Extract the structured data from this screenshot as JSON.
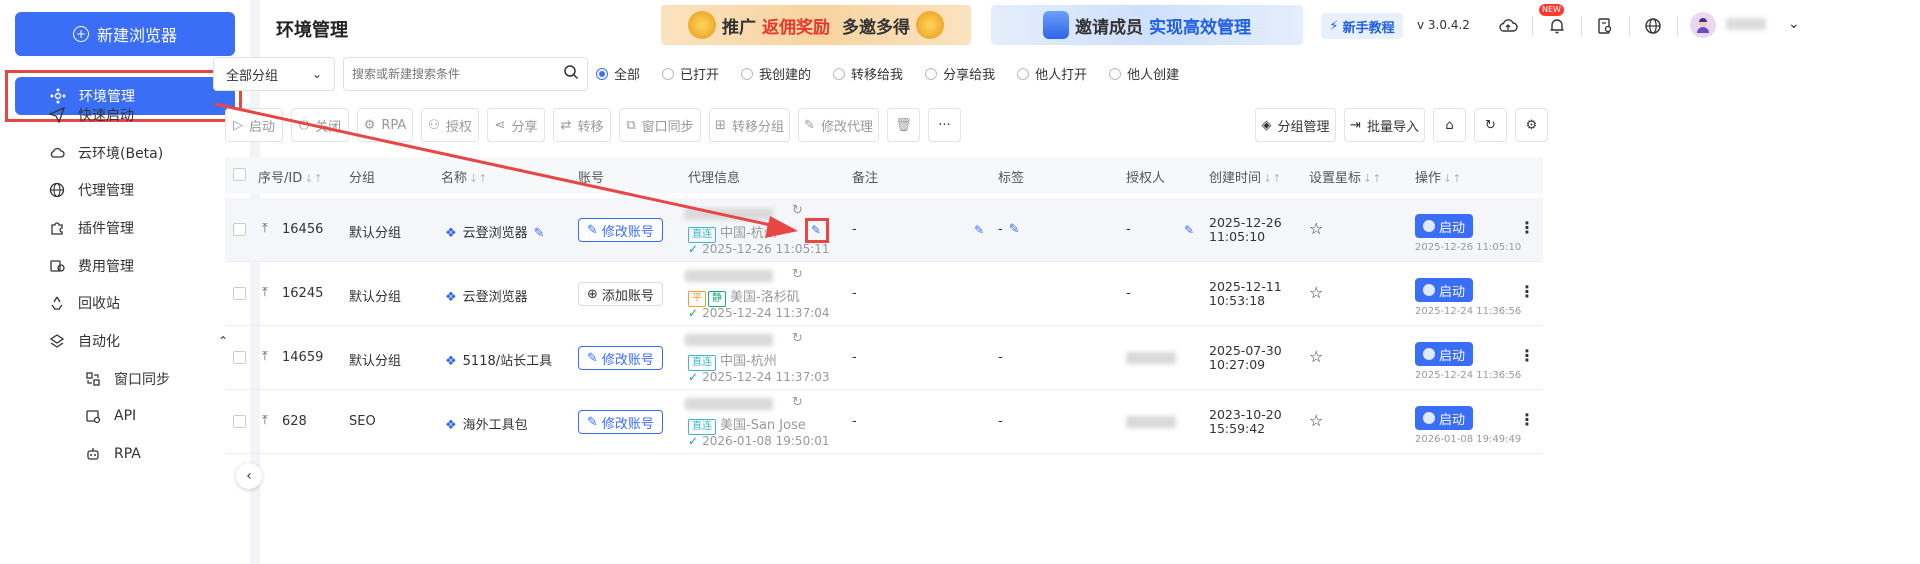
{
  "sidebar": {
    "new_browser": "新建浏览器",
    "items": [
      {
        "label": "环境管理"
      },
      {
        "label": "快速启动"
      },
      {
        "label": "云环境(Beta)"
      },
      {
        "label": "代理管理"
      },
      {
        "label": "插件管理"
      },
      {
        "label": "费用管理"
      },
      {
        "label": "回收站"
      },
      {
        "label": "自动化"
      },
      {
        "label": "窗口同步"
      },
      {
        "label": "API"
      },
      {
        "label": "RPA"
      }
    ]
  },
  "header": {
    "title": "环境管理",
    "banner1": {
      "part1": "推广",
      "part2": "返佣奖励",
      "part3": "多邀多得"
    },
    "banner2": {
      "part1": "邀请成员",
      "part2": "实现高效管理"
    },
    "tutorial": "新手教程",
    "version": "v 3.0.4.2",
    "new_badge": "NEW"
  },
  "filters": {
    "group_select": "全部分组",
    "search_placeholder": "搜索或新建搜索条件",
    "radios": [
      "全部",
      "已打开",
      "我创建的",
      "转移给我",
      "分享给我",
      "他人打开",
      "他人创建"
    ],
    "selected_radio": "全部"
  },
  "toolbar": {
    "start": "启动",
    "close": "关闭",
    "rpa": "RPA",
    "authorize": "授权",
    "share": "分享",
    "transfer": "转移",
    "window_sync": "窗口同步",
    "transfer_group": "转移分组",
    "modify_proxy": "修改代理",
    "more": "···",
    "group_manage": "分组管理",
    "batch_import": "批量导入"
  },
  "table": {
    "headers": [
      "序号/ID",
      "分组",
      "名称",
      "账号",
      "代理信息",
      "备注",
      "标签",
      "授权人",
      "创建时间",
      "设置星标",
      "操作"
    ],
    "rows": [
      {
        "id": "16456",
        "group": "默认分组",
        "name": "云登浏览器",
        "account": "修改账号",
        "proxy_tags": [
          "直连"
        ],
        "proxy_loc": "中国-杭州",
        "proxy_time": "2025-12-26 11:05:11",
        "note": "-",
        "tag": "-",
        "authorizer": "-",
        "created_date": "2025-12-26",
        "created_time": "11:05:10",
        "action": "启动",
        "action_time": "2025-12-26 11:05:10"
      },
      {
        "id": "16245",
        "group": "默认分组",
        "name": "云登浏览器",
        "account": "添加账号",
        "proxy_tags": [
          "平",
          "静"
        ],
        "proxy_loc": "美国-洛杉矶",
        "proxy_time": "2025-12-24 11:37:04",
        "note": "-",
        "tag": "",
        "authorizer": "-",
        "created_date": "2025-12-11",
        "created_time": "10:53:18",
        "action": "启动",
        "action_time": "2025-12-24 11:36:56"
      },
      {
        "id": "14659",
        "group": "默认分组",
        "name": "5118/站长工具",
        "account": "修改账号",
        "proxy_tags": [
          "直连"
        ],
        "proxy_loc": "中国-杭州",
        "proxy_time": "2025-12-24 11:37:03",
        "note": "-",
        "tag": "-",
        "authorizer": "",
        "created_date": "2025-07-30",
        "created_time": "10:27:09",
        "action": "启动",
        "action_time": "2025-12-24 11:36:56"
      },
      {
        "id": "628",
        "group": "SEO",
        "name": "海外工具包",
        "account": "修改账号",
        "proxy_tags": [
          "直连"
        ],
        "proxy_loc": "美国-San Jose",
        "proxy_time": "2026-01-08 19:50:01",
        "note": "-",
        "tag": "-",
        "authorizer": "",
        "created_date": "2023-10-20",
        "created_time": "15:59:42",
        "action": "启动",
        "action_time": "2026-01-08 19:49:49"
      }
    ]
  },
  "colors": {
    "primary": "#3a6ef6",
    "annotation": "#e84545",
    "success": "#19a97b"
  }
}
